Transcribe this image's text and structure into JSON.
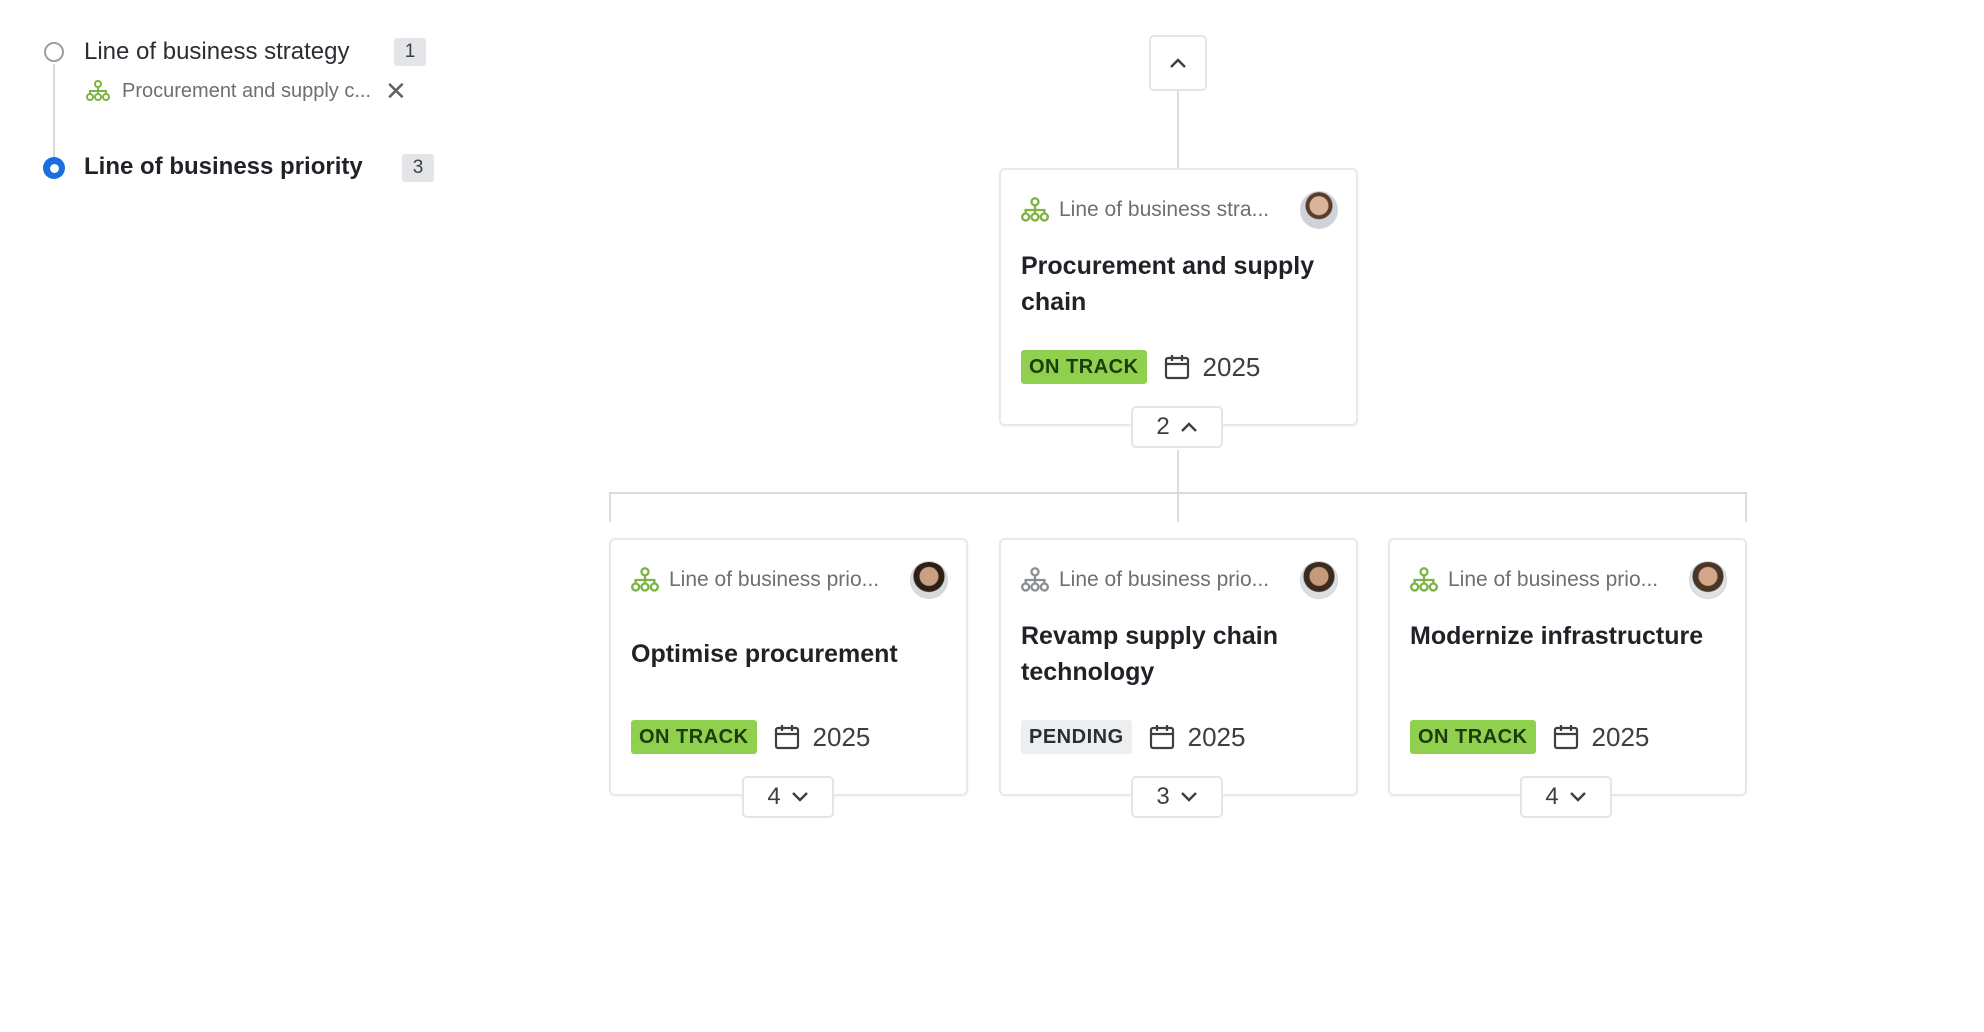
{
  "filters": {
    "levels": [
      {
        "label": "Line of business strategy",
        "count": "1",
        "selected": false
      },
      {
        "label": "Line of business priority",
        "count": "3",
        "selected": true
      }
    ],
    "applied_filter": {
      "label": "Procurement and supply c...",
      "icon": "hierarchy-icon"
    }
  },
  "tree": {
    "up_button_icon": "chevron-up-icon",
    "root": {
      "type_label": "Line of business stra...",
      "title": "Procurement and supply chain",
      "status": "ON TRACK",
      "year": "2025",
      "children_count": "2",
      "children_expanded": true
    },
    "children": [
      {
        "type_label": "Line of business prio...",
        "title": "Optimise procurement",
        "status": "ON TRACK",
        "year": "2025",
        "children_count": "4"
      },
      {
        "type_label": "Line of business prio...",
        "title": "Revamp supply chain technology",
        "status": "PENDING",
        "year": "2025",
        "children_count": "3"
      },
      {
        "type_label": "Line of business prio...",
        "title": "Modernize infrastructure",
        "status": "ON TRACK",
        "year": "2025",
        "children_count": "4"
      }
    ]
  },
  "colors": {
    "accent_blue": "#1a6fe0",
    "on_track_green": "#8fd14f",
    "pending_gray": "#eceef0",
    "hierarchy_icon_green": "#7cb342",
    "hierarchy_icon_gray": "#8a8f94"
  }
}
